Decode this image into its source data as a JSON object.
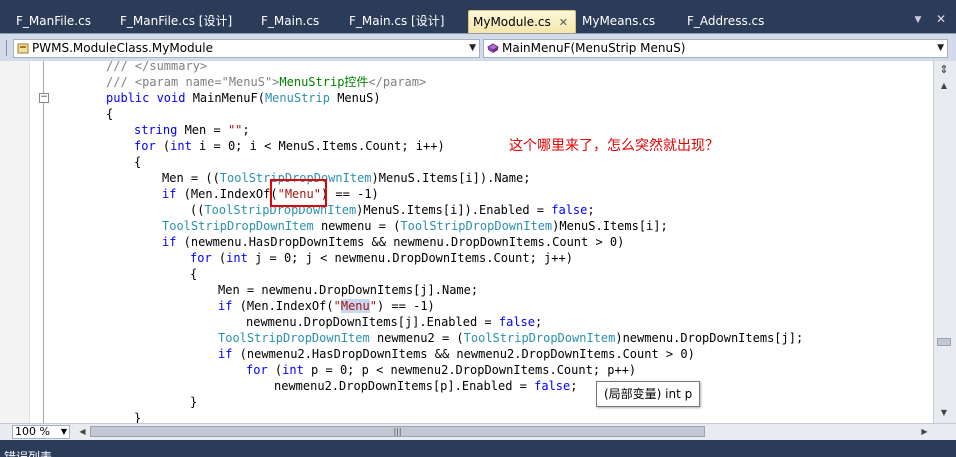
{
  "tabs": [
    {
      "label": "F_ManFile.cs",
      "active": false
    },
    {
      "label": "F_ManFile.cs [设计]",
      "active": false
    },
    {
      "label": "F_Main.cs",
      "active": false
    },
    {
      "label": "F_Main.cs [设计]",
      "active": false
    },
    {
      "label": "MyModule.cs",
      "active": true
    },
    {
      "label": "MyMeans.cs",
      "active": false
    },
    {
      "label": "F_Address.cs",
      "active": false
    }
  ],
  "tab_close_glyph": "✕",
  "tab_overflow_icon": "dropdown-icon",
  "window_close_glyph": "✕",
  "navbar": {
    "type_selector": "PWMS.ModuleClass.MyModule",
    "member_selector": "MainMenuF(MenuStrip MenuS)"
  },
  "code_lines": {
    "l0": {
      "a": "/// </summary>"
    },
    "l1": {
      "a": "/// <param name=\"MenuS\">",
      "b": "MenuStrip控件",
      "c": "</param>"
    },
    "l2": {
      "a": "public void ",
      "b": "MainMenuF(",
      "c": "MenuStrip",
      "d": " MenuS)"
    },
    "l3": {
      "a": "{"
    },
    "l4": {
      "a": "string",
      "b": " Men = ",
      "c": "\"\"",
      "d": ";"
    },
    "l5": {
      "a": "for",
      "b": " (",
      "c": "int",
      "d": " i = 0; i < MenuS.Items.Count; i++)"
    },
    "l6": {
      "a": "{"
    },
    "l7": {
      "a": "Men = ((",
      "b": "ToolStripDropDownItem",
      "c": ")MenuS.Items[i]).Name;"
    },
    "l8": {
      "a": "if",
      "b": " (Men.IndexOf(",
      "c": "\"Menu\"",
      "d": ") == -1)"
    },
    "l9": {
      "a": "((",
      "b": "ToolStripDropDownItem",
      "c": ")MenuS.Items[i]).Enabled = ",
      "d": "false",
      "e": ";"
    },
    "l10": {
      "a": "ToolStripDropDownItem",
      "b": " newmenu = (",
      "c": "ToolStripDropDownItem",
      "d": ")MenuS.Items[i];"
    },
    "l11": {
      "a": "if",
      "b": " (newmenu.HasDropDownItems && newmenu.DropDownItems.Count > 0)"
    },
    "l12": {
      "a": "for",
      "b": " (",
      "c": "int",
      "d": " j = 0; j < newmenu.DropDownItems.Count; j++)"
    },
    "l13": {
      "a": "{"
    },
    "l14": {
      "a": "Men = newmenu.DropDownItems[j].Name;"
    },
    "l15": {
      "a": "if",
      "b": " (Men.IndexOf(",
      "c": "\"",
      "d": "Menu",
      "e": "\"",
      "f": ") == -1)"
    },
    "l16": {
      "a": "newmenu.DropDownItems[j].Enabled = ",
      "b": "false",
      "c": ";"
    },
    "l17": {
      "a": "ToolStripDropDownItem",
      "b": " newmenu2 = (",
      "c": "ToolStripDropDownItem",
      "d": ")newmenu.DropDownItems[j];"
    },
    "l18": {
      "a": "if",
      "b": " (newmenu2.HasDropDownItems && newmenu2.DropDownItems.Count > 0)"
    },
    "l19": {
      "a": "for",
      "b": " (",
      "c": "int",
      "d": " p = 0; p < newmenu2.DropDownItems.Count; p++)"
    },
    "l20": {
      "a": "newmenu2.DropDownItems[p].Enabled = ",
      "b": "false",
      "c": ";"
    },
    "l21": {
      "a": "}"
    },
    "l22": {
      "a": "}"
    }
  },
  "annotation_text": "这个哪里来了，怎么突然就出现？",
  "tooltip": "(局部变量) int p",
  "zoom": "100 %",
  "bottom_panel_title": "错误列表",
  "colors": {
    "keyword": "#0000ff",
    "type": "#2b91af",
    "string": "#a31515",
    "comment": "#008000",
    "annotation": "#e60000",
    "chrome_dark": "#2b3c59"
  }
}
